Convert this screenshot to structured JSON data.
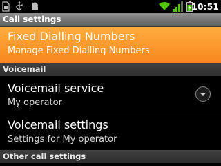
{
  "status_bar": {
    "time": "10:51",
    "icons": [
      "sim-card-icon",
      "usb-icon",
      "android-debug-icon",
      "wifi-icon",
      "signal-icon",
      "battery-icon"
    ]
  },
  "title": "Call settings",
  "fdn": {
    "title": "Fixed Dialling Numbers",
    "subtitle": "Manage Fixed Dialling Numbers"
  },
  "voicemail_section": {
    "header": "Voicemail",
    "service": {
      "title": "Voicemail service",
      "subtitle": "My operator"
    },
    "settings": {
      "title": "Voicemail settings",
      "subtitle": "Settings for My operator"
    }
  },
  "other_section": {
    "header": "Other call settings"
  },
  "colors": {
    "accent": "#f7871e",
    "background": "#000000",
    "battery": "#4fc600"
  }
}
